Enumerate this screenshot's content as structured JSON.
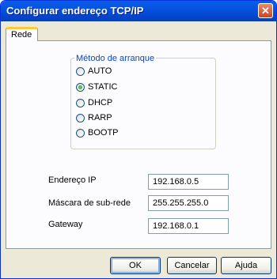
{
  "window": {
    "title": "Configurar endereço TCP/IP",
    "close_glyph": "✕"
  },
  "tabs": [
    {
      "label": "Rede"
    }
  ],
  "boot_method": {
    "legend": "Método de arranque",
    "options": [
      {
        "label": "AUTO",
        "checked": false
      },
      {
        "label": "STATIC",
        "checked": true
      },
      {
        "label": "DHCP",
        "checked": false
      },
      {
        "label": "RARP",
        "checked": false
      },
      {
        "label": "BOOTP",
        "checked": false
      }
    ]
  },
  "fields": {
    "ip": {
      "label": "Endereço IP",
      "value": "192.168.0.5"
    },
    "subnet": {
      "label": "Máscara de sub-rede",
      "value": "255.255.255.0"
    },
    "gateway": {
      "label": "Gateway",
      "value": "192.168.0.1"
    }
  },
  "buttons": {
    "ok": "OK",
    "cancel": "Cancelar",
    "help": "Ajuda"
  }
}
